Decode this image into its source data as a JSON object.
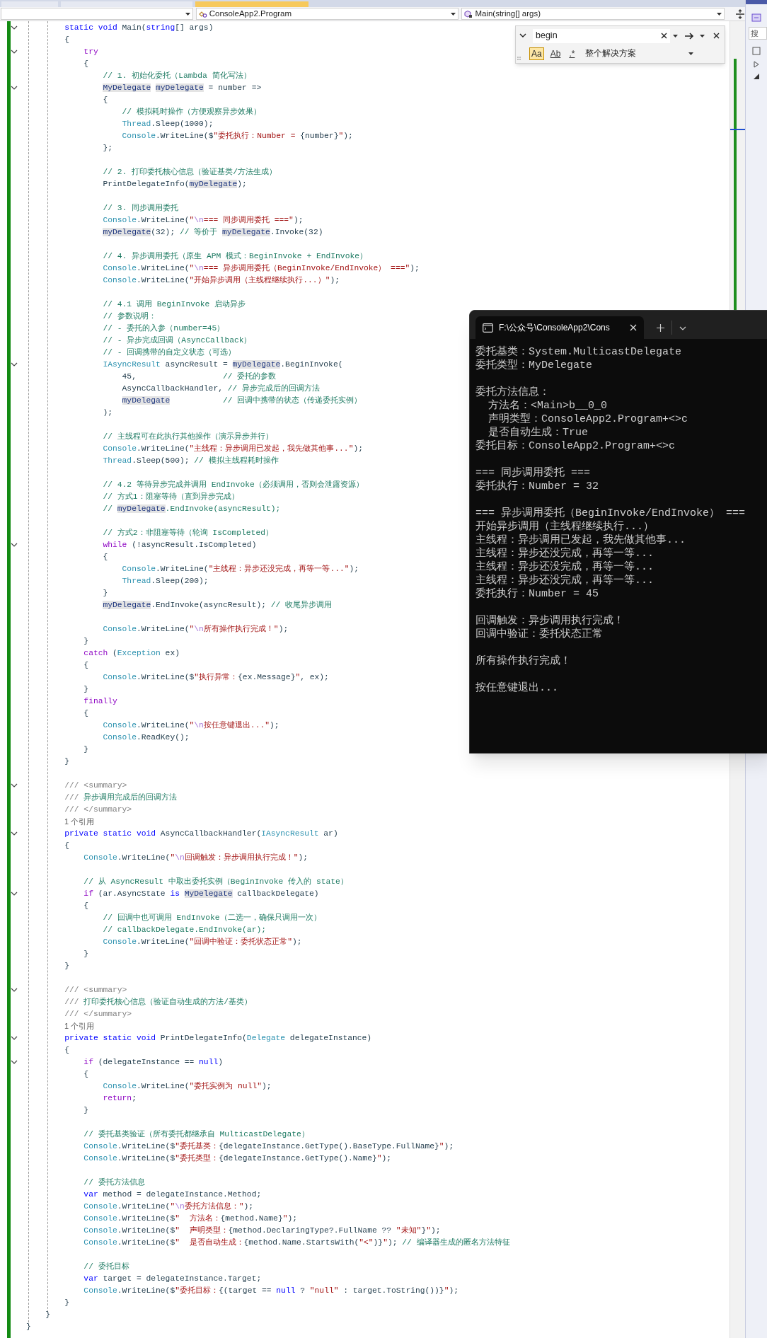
{
  "document_tabs": [
    {
      "selected": false
    },
    {
      "selected": false
    },
    {
      "selected": true
    }
  ],
  "navigation_bar": {
    "type_dropdown": "ConsoleApp2.Program",
    "member_dropdown": "Main(string[] args)"
  },
  "find_widget": {
    "query": "begin",
    "options": [
      {
        "label": "Aa",
        "selected": true
      },
      {
        "label": "Ab",
        "selected": false
      },
      {
        "label": ".*",
        "selected": false
      }
    ],
    "scope": "整个解决方案"
  },
  "code_lines": [
    {
      "fold": true,
      "segs": [
        {
          "kind": "kw",
          "text": "        static void "
        },
        {
          "kind": "code",
          "text": "Main("
        },
        {
          "kind": "kw",
          "text": "string"
        },
        {
          "kind": "code",
          "text": "[] args)"
        }
      ]
    },
    {
      "fold": false,
      "segs": [
        {
          "kind": "code",
          "text": "        {"
        }
      ]
    },
    {
      "fold": true,
      "segs": [
        {
          "kind": "ctl",
          "text": "            try"
        }
      ]
    },
    {
      "fold": false,
      "segs": [
        {
          "kind": "code",
          "text": "            {"
        }
      ]
    },
    {
      "fold": false,
      "segs": [
        {
          "kind": "com",
          "text": "                // 1. 初始化委托（Lambda 简化写法）"
        }
      ]
    },
    {
      "fold": true,
      "segs": [
        {
          "kind": "hl",
          "text": "                MyDelegate "
        },
        {
          "kind": "hl",
          "text": "myDelegate"
        },
        {
          "kind": "code",
          "text": " = number =>"
        }
      ]
    },
    {
      "fold": false,
      "segs": [
        {
          "kind": "code",
          "text": "                {"
        }
      ]
    },
    {
      "fold": false,
      "segs": [
        {
          "kind": "com",
          "text": "                    // 模拟耗时操作（方便观察异步效果）"
        }
      ]
    },
    {
      "fold": false,
      "segs": [
        {
          "kind": "type",
          "text": "                    Thread"
        },
        {
          "kind": "code",
          "text": ".Sleep(1000);"
        }
      ]
    },
    {
      "fold": false,
      "segs": [
        {
          "kind": "type",
          "text": "                    Console"
        },
        {
          "kind": "code",
          "text": ".WriteLine($"
        },
        {
          "kind": "str",
          "text": "\"委托执行：Number = "
        },
        {
          "kind": "code",
          "text": "{number}"
        },
        {
          "kind": "str",
          "text": "\""
        },
        {
          "kind": "code",
          "text": ");"
        }
      ]
    },
    {
      "fold": false,
      "segs": [
        {
          "kind": "code",
          "text": "                };"
        }
      ]
    },
    {
      "kind": "blank"
    },
    {
      "fold": false,
      "segs": [
        {
          "kind": "com",
          "text": "                // 2. 打印委托核心信息（验证基类/方法生成）"
        }
      ]
    },
    {
      "fold": false,
      "segs": [
        {
          "kind": "code",
          "text": "                PrintDelegateInfo("
        },
        {
          "kind": "hl",
          "text": "myDelegate"
        },
        {
          "kind": "code",
          "text": ");"
        }
      ]
    },
    {
      "kind": "blank"
    },
    {
      "fold": false,
      "segs": [
        {
          "kind": "com",
          "text": "                // 3. 同步调用委托"
        }
      ]
    },
    {
      "fold": false,
      "segs": [
        {
          "kind": "type",
          "text": "                Console"
        },
        {
          "kind": "code",
          "text": ".WriteLine("
        },
        {
          "kind": "str",
          "text": "\""
        },
        {
          "kind": "esc",
          "text": "\\n"
        },
        {
          "kind": "str",
          "text": "=== 同步调用委托 ===\""
        },
        {
          "kind": "code",
          "text": ");"
        }
      ]
    },
    {
      "fold": false,
      "segs": [
        {
          "kind": "hl",
          "text": "                myDelegate"
        },
        {
          "kind": "code",
          "text": "(32); "
        },
        {
          "kind": "com",
          "text": "// 等价于 "
        },
        {
          "kind": "hl",
          "text": "myDelegate"
        },
        {
          "kind": "code",
          "text": ".Invoke(32)"
        }
      ]
    },
    {
      "kind": "blank"
    },
    {
      "fold": false,
      "segs": [
        {
          "kind": "com",
          "text": "                // 4. 异步调用委托（原生 APM 模式：BeginInvoke + EndInvoke）"
        }
      ]
    },
    {
      "fold": false,
      "segs": [
        {
          "kind": "type",
          "text": "                Console"
        },
        {
          "kind": "code",
          "text": ".WriteLine("
        },
        {
          "kind": "str",
          "text": "\""
        },
        {
          "kind": "esc",
          "text": "\\n"
        },
        {
          "kind": "str",
          "text": "=== 异步调用委托（BeginInvoke/EndInvoke） ===\""
        },
        {
          "kind": "code",
          "text": ");"
        }
      ]
    },
    {
      "fold": false,
      "segs": [
        {
          "kind": "type",
          "text": "                Console"
        },
        {
          "kind": "code",
          "text": ".WriteLine("
        },
        {
          "kind": "str",
          "text": "\"开始异步调用（主线程继续执行...）\""
        },
        {
          "kind": "code",
          "text": ");"
        }
      ]
    },
    {
      "kind": "blank"
    },
    {
      "fold": false,
      "segs": [
        {
          "kind": "com",
          "text": "                // 4.1 调用 BeginInvoke 启动异步"
        }
      ]
    },
    {
      "fold": false,
      "segs": [
        {
          "kind": "com",
          "text": "                // 参数说明："
        }
      ]
    },
    {
      "fold": false,
      "segs": [
        {
          "kind": "com",
          "text": "                // - 委托的入参（number=45）"
        }
      ]
    },
    {
      "fold": false,
      "segs": [
        {
          "kind": "com",
          "text": "                // - 异步完成回调（AsyncCallback）"
        }
      ]
    },
    {
      "fold": false,
      "segs": [
        {
          "kind": "com",
          "text": "                // - 回调携带的自定义状态（可选）"
        }
      ]
    },
    {
      "fold": true,
      "segs": [
        {
          "kind": "type",
          "text": "                IAsyncResult"
        },
        {
          "kind": "code",
          "text": " asyncResult = "
        },
        {
          "kind": "hl",
          "text": "myDelegate"
        },
        {
          "kind": "code",
          "text": ".BeginInvoke("
        }
      ]
    },
    {
      "fold": false,
      "segs": [
        {
          "kind": "code",
          "text": "                    45,                  "
        },
        {
          "kind": "com",
          "text": "// 委托的参数"
        }
      ]
    },
    {
      "fold": false,
      "segs": [
        {
          "kind": "code",
          "text": "                    AsyncCallbackHandler, "
        },
        {
          "kind": "com",
          "text": "// 异步完成后的回调方法"
        }
      ]
    },
    {
      "fold": false,
      "segs": [
        {
          "kind": "hl",
          "text": "                    myDelegate           "
        },
        {
          "kind": "com",
          "text": "// 回调中携带的状态（传递委托实例）"
        }
      ]
    },
    {
      "fold": false,
      "segs": [
        {
          "kind": "code",
          "text": "                );"
        }
      ]
    },
    {
      "kind": "blank"
    },
    {
      "fold": false,
      "segs": [
        {
          "kind": "com",
          "text": "                // 主线程可在此执行其他操作（演示异步并行）"
        }
      ]
    },
    {
      "fold": false,
      "segs": [
        {
          "kind": "type",
          "text": "                Console"
        },
        {
          "kind": "code",
          "text": ".WriteLine("
        },
        {
          "kind": "str",
          "text": "\"主线程：异步调用已发起，我先做其他事...\""
        },
        {
          "kind": "code",
          "text": ");"
        }
      ]
    },
    {
      "fold": false,
      "segs": [
        {
          "kind": "type",
          "text": "                Thread"
        },
        {
          "kind": "code",
          "text": ".Sleep(500); "
        },
        {
          "kind": "com",
          "text": "// 模拟主线程耗时操作"
        }
      ]
    },
    {
      "kind": "blank"
    },
    {
      "fold": false,
      "segs": [
        {
          "kind": "com",
          "text": "                // 4.2 等待异步完成并调用 EndInvoke（必须调用，否则会泄露资源）"
        }
      ]
    },
    {
      "fold": false,
      "segs": [
        {
          "kind": "com",
          "text": "                // 方式1：阻塞等待（直到异步完成）"
        }
      ]
    },
    {
      "fold": false,
      "segs": [
        {
          "kind": "com",
          "text": "                // "
        },
        {
          "kind": "hl",
          "text": "myDelegate"
        },
        {
          "kind": "com",
          "text": ".EndInvoke(asyncResult);"
        }
      ]
    },
    {
      "kind": "blank"
    },
    {
      "fold": false,
      "segs": [
        {
          "kind": "com",
          "text": "                // 方式2：非阻塞等待（轮询 IsCompleted）"
        }
      ]
    },
    {
      "fold": true,
      "segs": [
        {
          "kind": "ctl",
          "text": "                while"
        },
        {
          "kind": "code",
          "text": " (!asyncResult.IsCompleted)"
        }
      ]
    },
    {
      "fold": false,
      "segs": [
        {
          "kind": "code",
          "text": "                {"
        }
      ]
    },
    {
      "fold": false,
      "segs": [
        {
          "kind": "type",
          "text": "                    Console"
        },
        {
          "kind": "code",
          "text": ".WriteLine("
        },
        {
          "kind": "str",
          "text": "\"主线程：异步还没完成，再等一等...\""
        },
        {
          "kind": "code",
          "text": ");"
        }
      ]
    },
    {
      "fold": false,
      "segs": [
        {
          "kind": "type",
          "text": "                    Thread"
        },
        {
          "kind": "code",
          "text": ".Sleep(200);"
        }
      ]
    },
    {
      "fold": false,
      "segs": [
        {
          "kind": "code",
          "text": "                }"
        }
      ]
    },
    {
      "fold": false,
      "segs": [
        {
          "kind": "hl",
          "text": "                myDelegate"
        },
        {
          "kind": "code",
          "text": ".EndInvoke(asyncResult); "
        },
        {
          "kind": "com",
          "text": "// 收尾异步调用"
        }
      ]
    },
    {
      "kind": "blank"
    },
    {
      "fold": false,
      "segs": [
        {
          "kind": "type",
          "text": "                Console"
        },
        {
          "kind": "code",
          "text": ".WriteLine("
        },
        {
          "kind": "str",
          "text": "\""
        },
        {
          "kind": "esc",
          "text": "\\n"
        },
        {
          "kind": "str",
          "text": "所有操作执行完成！\""
        },
        {
          "kind": "code",
          "text": ");"
        }
      ]
    },
    {
      "fold": false,
      "segs": [
        {
          "kind": "code",
          "text": "            }"
        }
      ]
    },
    {
      "fold": false,
      "segs": [
        {
          "kind": "ctl",
          "text": "            catch"
        },
        {
          "kind": "code",
          "text": " ("
        },
        {
          "kind": "type",
          "text": "Exception"
        },
        {
          "kind": "code",
          "text": " ex)"
        }
      ]
    },
    {
      "fold": false,
      "segs": [
        {
          "kind": "code",
          "text": "            {"
        }
      ]
    },
    {
      "fold": false,
      "segs": [
        {
          "kind": "type",
          "text": "                Console"
        },
        {
          "kind": "code",
          "text": ".WriteLine($"
        },
        {
          "kind": "str",
          "text": "\"执行异常："
        },
        {
          "kind": "code",
          "text": "{ex.Message}"
        },
        {
          "kind": "str",
          "text": "\""
        },
        {
          "kind": "code",
          "text": ", ex);"
        }
      ]
    },
    {
      "fold": false,
      "segs": [
        {
          "kind": "code",
          "text": "            }"
        }
      ]
    },
    {
      "fold": false,
      "segs": [
        {
          "kind": "ctl",
          "text": "            finally"
        }
      ]
    },
    {
      "fold": false,
      "segs": [
        {
          "kind": "code",
          "text": "            {"
        }
      ]
    },
    {
      "fold": false,
      "segs": [
        {
          "kind": "type",
          "text": "                Console"
        },
        {
          "kind": "code",
          "text": ".WriteLine("
        },
        {
          "kind": "str",
          "text": "\""
        },
        {
          "kind": "esc",
          "text": "\\n"
        },
        {
          "kind": "str",
          "text": "按任意键退出...\""
        },
        {
          "kind": "code",
          "text": ");"
        }
      ]
    },
    {
      "fold": false,
      "segs": [
        {
          "kind": "type",
          "text": "                Console"
        },
        {
          "kind": "code",
          "text": ".ReadKey();"
        }
      ]
    },
    {
      "fold": false,
      "segs": [
        {
          "kind": "code",
          "text": "            }"
        }
      ]
    },
    {
      "fold": false,
      "segs": [
        {
          "kind": "code",
          "text": "        }"
        }
      ]
    },
    {
      "kind": "blank"
    },
    {
      "fold": true,
      "segs": [
        {
          "kind": "doc",
          "text": "        /// <summary>"
        }
      ]
    },
    {
      "fold": false,
      "segs": [
        {
          "kind": "doc",
          "text": "        /// "
        },
        {
          "kind": "com",
          "text": "异步调用完成后的回调方法"
        }
      ]
    },
    {
      "fold": false,
      "segs": [
        {
          "kind": "doc",
          "text": "        /// </summary>"
        }
      ]
    },
    {
      "kind": "lens",
      "text": "1 个引用"
    },
    {
      "fold": true,
      "segs": [
        {
          "kind": "kw",
          "text": "        private static void "
        },
        {
          "kind": "code",
          "text": "AsyncCallbackHandler("
        },
        {
          "kind": "type",
          "text": "IAsyncResult"
        },
        {
          "kind": "code",
          "text": " ar)"
        }
      ]
    },
    {
      "fold": false,
      "segs": [
        {
          "kind": "code",
          "text": "        {"
        }
      ]
    },
    {
      "fold": false,
      "segs": [
        {
          "kind": "type",
          "text": "            Console"
        },
        {
          "kind": "code",
          "text": ".WriteLine("
        },
        {
          "kind": "str",
          "text": "\""
        },
        {
          "kind": "esc",
          "text": "\\n"
        },
        {
          "kind": "str",
          "text": "回调触发：异步调用执行完成！\""
        },
        {
          "kind": "code",
          "text": ");"
        }
      ]
    },
    {
      "kind": "blank"
    },
    {
      "fold": false,
      "segs": [
        {
          "kind": "com",
          "text": "            // 从 AsyncResult 中取出委托实例（BeginInvoke 传入的 state）"
        }
      ]
    },
    {
      "fold": true,
      "segs": [
        {
          "kind": "ctl",
          "text": "            if"
        },
        {
          "kind": "code",
          "text": " (ar.AsyncState "
        },
        {
          "kind": "kw",
          "text": "is "
        },
        {
          "kind": "hl",
          "text": "MyDelegate"
        },
        {
          "kind": "code",
          "text": " callbackDelegate)"
        }
      ]
    },
    {
      "fold": false,
      "segs": [
        {
          "kind": "code",
          "text": "            {"
        }
      ]
    },
    {
      "fold": false,
      "segs": [
        {
          "kind": "com",
          "text": "                // 回调中也可调用 EndInvoke（二选一，确保只调用一次）"
        }
      ]
    },
    {
      "fold": false,
      "segs": [
        {
          "kind": "com",
          "text": "                // callbackDelegate.EndInvoke(ar);"
        }
      ]
    },
    {
      "fold": false,
      "segs": [
        {
          "kind": "type",
          "text": "                Console"
        },
        {
          "kind": "code",
          "text": ".WriteLine("
        },
        {
          "kind": "str",
          "text": "\"回调中验证：委托状态正常\""
        },
        {
          "kind": "code",
          "text": ");"
        }
      ]
    },
    {
      "fold": false,
      "segs": [
        {
          "kind": "code",
          "text": "            }"
        }
      ]
    },
    {
      "fold": false,
      "segs": [
        {
          "kind": "code",
          "text": "        }"
        }
      ]
    },
    {
      "kind": "blank"
    },
    {
      "fold": true,
      "segs": [
        {
          "kind": "doc",
          "text": "        /// <summary>"
        }
      ]
    },
    {
      "fold": false,
      "segs": [
        {
          "kind": "doc",
          "text": "        /// "
        },
        {
          "kind": "com",
          "text": "打印委托核心信息（验证自动生成的方法/基类）"
        }
      ]
    },
    {
      "fold": false,
      "segs": [
        {
          "kind": "doc",
          "text": "        /// </summary>"
        }
      ]
    },
    {
      "kind": "lens",
      "text": "1 个引用"
    },
    {
      "fold": true,
      "segs": [
        {
          "kind": "kw",
          "text": "        private static void "
        },
        {
          "kind": "code",
          "text": "PrintDelegateInfo("
        },
        {
          "kind": "type",
          "text": "Delegate"
        },
        {
          "kind": "code",
          "text": " delegateInstance)"
        }
      ]
    },
    {
      "fold": false,
      "segs": [
        {
          "kind": "code",
          "text": "        {"
        }
      ]
    },
    {
      "fold": true,
      "segs": [
        {
          "kind": "ctl",
          "text": "            if"
        },
        {
          "kind": "code",
          "text": " (delegateInstance == "
        },
        {
          "kind": "kw",
          "text": "null"
        },
        {
          "kind": "code",
          "text": ")"
        }
      ]
    },
    {
      "fold": false,
      "segs": [
        {
          "kind": "code",
          "text": "            {"
        }
      ]
    },
    {
      "fold": false,
      "segs": [
        {
          "kind": "type",
          "text": "                Console"
        },
        {
          "kind": "code",
          "text": ".WriteLine("
        },
        {
          "kind": "str",
          "text": "\"委托实例为 null\""
        },
        {
          "kind": "code",
          "text": ");"
        }
      ]
    },
    {
      "fold": false,
      "segs": [
        {
          "kind": "ctl",
          "text": "                return"
        },
        {
          "kind": "code",
          "text": ";"
        }
      ]
    },
    {
      "fold": false,
      "segs": [
        {
          "kind": "code",
          "text": "            }"
        }
      ]
    },
    {
      "kind": "blank"
    },
    {
      "fold": false,
      "segs": [
        {
          "kind": "com",
          "text": "            // 委托基类验证（所有委托都继承自 MulticastDelegate）"
        }
      ]
    },
    {
      "fold": false,
      "segs": [
        {
          "kind": "type",
          "text": "            Console"
        },
        {
          "kind": "code",
          "text": ".WriteLine($"
        },
        {
          "kind": "str",
          "text": "\"委托基类："
        },
        {
          "kind": "code",
          "text": "{delegateInstance.GetType().BaseType.FullName}"
        },
        {
          "kind": "str",
          "text": "\""
        },
        {
          "kind": "code",
          "text": ");"
        }
      ]
    },
    {
      "fold": false,
      "segs": [
        {
          "kind": "type",
          "text": "            Console"
        },
        {
          "kind": "code",
          "text": ".WriteLine($"
        },
        {
          "kind": "str",
          "text": "\"委托类型："
        },
        {
          "kind": "code",
          "text": "{delegateInstance.GetType().Name}"
        },
        {
          "kind": "str",
          "text": "\""
        },
        {
          "kind": "code",
          "text": ");"
        }
      ]
    },
    {
      "kind": "blank"
    },
    {
      "fold": false,
      "segs": [
        {
          "kind": "com",
          "text": "            // 委托方法信息"
        }
      ]
    },
    {
      "fold": false,
      "segs": [
        {
          "kind": "kw",
          "text": "            var"
        },
        {
          "kind": "code",
          "text": " method = delegateInstance.Method;"
        }
      ]
    },
    {
      "fold": false,
      "segs": [
        {
          "kind": "type",
          "text": "            Console"
        },
        {
          "kind": "code",
          "text": ".WriteLine("
        },
        {
          "kind": "str",
          "text": "\""
        },
        {
          "kind": "esc",
          "text": "\\n"
        },
        {
          "kind": "str",
          "text": "委托方法信息：\""
        },
        {
          "kind": "code",
          "text": ");"
        }
      ]
    },
    {
      "fold": false,
      "segs": [
        {
          "kind": "type",
          "text": "            Console"
        },
        {
          "kind": "code",
          "text": ".WriteLine($"
        },
        {
          "kind": "str",
          "text": "\"  方法名："
        },
        {
          "kind": "code",
          "text": "{method.Name}"
        },
        {
          "kind": "str",
          "text": "\""
        },
        {
          "kind": "code",
          "text": ");"
        }
      ]
    },
    {
      "fold": false,
      "segs": [
        {
          "kind": "type",
          "text": "            Console"
        },
        {
          "kind": "code",
          "text": ".WriteLine($"
        },
        {
          "kind": "str",
          "text": "\"  声明类型："
        },
        {
          "kind": "code",
          "text": "{method.DeclaringType?.FullName ?? "
        },
        {
          "kind": "str",
          "text": "\"未知\""
        },
        {
          "kind": "code",
          "text": "}"
        },
        {
          "kind": "str",
          "text": "\""
        },
        {
          "kind": "code",
          "text": ");"
        }
      ]
    },
    {
      "fold": false,
      "segs": [
        {
          "kind": "type",
          "text": "            Console"
        },
        {
          "kind": "code",
          "text": ".WriteLine($"
        },
        {
          "kind": "str",
          "text": "\"  是否自动生成："
        },
        {
          "kind": "code",
          "text": "{method.Name.StartsWith("
        },
        {
          "kind": "str",
          "text": "\"<\""
        },
        {
          "kind": "code",
          "text": ")}"
        },
        {
          "kind": "str",
          "text": "\""
        },
        {
          "kind": "code",
          "text": "); "
        },
        {
          "kind": "com",
          "text": "// 编译器生成的匿名方法特征"
        }
      ]
    },
    {
      "kind": "blank"
    },
    {
      "fold": false,
      "segs": [
        {
          "kind": "com",
          "text": "            // 委托目标"
        }
      ]
    },
    {
      "fold": false,
      "segs": [
        {
          "kind": "kw",
          "text": "            var"
        },
        {
          "kind": "code",
          "text": " target = delegateInstance.Target;"
        }
      ]
    },
    {
      "fold": false,
      "segs": [
        {
          "kind": "type",
          "text": "            Console"
        },
        {
          "kind": "code",
          "text": ".WriteLine($"
        },
        {
          "kind": "str",
          "text": "\"委托目标："
        },
        {
          "kind": "code",
          "text": "{(target == "
        },
        {
          "kind": "kw",
          "text": "null"
        },
        {
          "kind": "code",
          "text": " ? "
        },
        {
          "kind": "str",
          "text": "\"null\""
        },
        {
          "kind": "code",
          "text": " : target.ToString())}"
        },
        {
          "kind": "str",
          "text": "\""
        },
        {
          "kind": "code",
          "text": ");"
        }
      ]
    },
    {
      "fold": false,
      "segs": [
        {
          "kind": "code",
          "text": "        }"
        }
      ]
    },
    {
      "fold": false,
      "segs": [
        {
          "kind": "code",
          "text": "    }"
        }
      ]
    },
    {
      "fold": false,
      "segs": [
        {
          "kind": "code",
          "text": "}"
        }
      ]
    }
  ],
  "console_window": {
    "tab_title": "F:\\公众号\\ConsoleApp2\\Cons",
    "output_blocks": [
      [
        "委托基类：System.MulticastDelegate",
        "委托类型：MyDelegate"
      ],
      [
        "委托方法信息：",
        "  方法名：<Main>b__0_0",
        "  声明类型：ConsoleApp2.Program+<>c",
        "  是否自动生成：True",
        "委托目标：ConsoleApp2.Program+<>c"
      ],
      [
        "=== 同步调用委托 ===",
        "委托执行：Number = 32"
      ],
      [
        "=== 异步调用委托（BeginInvoke/EndInvoke） ===",
        "开始异步调用（主线程继续执行...）",
        "主线程：异步调用已发起，我先做其他事...",
        "主线程：异步还没完成，再等一等...",
        "主线程：异步还没完成，再等一等...",
        "主线程：异步还没完成，再等一等...",
        "委托执行：Number = 45"
      ],
      [
        "回调触发：异步调用执行完成！",
        "回调中验证：委托状态正常"
      ],
      [
        "所有操作执行完成！"
      ],
      [
        "按任意键退出..."
      ]
    ]
  },
  "solution_panel": {
    "search_placeholder": "搜"
  }
}
